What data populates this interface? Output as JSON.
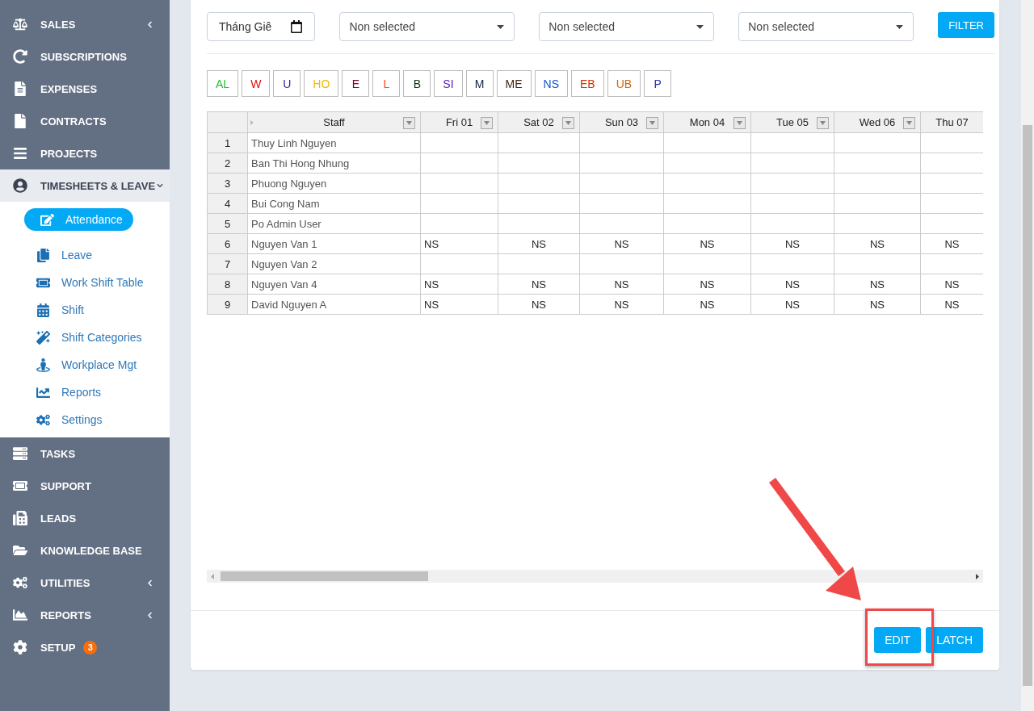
{
  "sidebar": {
    "items": [
      {
        "label": "SALES",
        "expanded": false
      },
      {
        "label": "SUBSCRIPTIONS"
      },
      {
        "label": "EXPENSES"
      },
      {
        "label": "CONTRACTS"
      },
      {
        "label": "PROJECTS"
      },
      {
        "label": "TIMESHEETS & LEAVE",
        "expanded": true,
        "children": [
          {
            "label": "Attendance",
            "selected": true
          },
          {
            "label": "Leave",
            "selected": false
          },
          {
            "label": "Work Shift Table",
            "selected": false
          },
          {
            "label": "Shift",
            "selected": false
          },
          {
            "label": "Shift Categories",
            "selected": false
          },
          {
            "label": "Workplace Mgt",
            "selected": false
          },
          {
            "label": "Reports",
            "selected": false
          },
          {
            "label": "Settings",
            "selected": false
          }
        ]
      },
      {
        "label": "TASKS"
      },
      {
        "label": "SUPPORT"
      },
      {
        "label": "LEADS"
      },
      {
        "label": "KNOWLEDGE BASE"
      },
      {
        "label": "UTILITIES",
        "expanded": false
      },
      {
        "label": "REPORTS",
        "expanded": false
      },
      {
        "label": "SETUP",
        "badge": "3"
      }
    ]
  },
  "filters": {
    "month": {
      "value": "Tháng Giê"
    },
    "selects": [
      {
        "value": "Non selected"
      },
      {
        "value": "Non selected"
      },
      {
        "value": "Non selected"
      }
    ],
    "button": "FILTER"
  },
  "legend": [
    {
      "code": "AL",
      "color": "#22bb33"
    },
    {
      "code": "W",
      "color": "#dd1111"
    },
    {
      "code": "U",
      "color": "#3322aa"
    },
    {
      "code": "HO",
      "color": "#f5b800"
    },
    {
      "code": "E",
      "color": "#770033"
    },
    {
      "code": "L",
      "color": "#ff4422"
    },
    {
      "code": "B",
      "color": "#113311"
    },
    {
      "code": "SI",
      "color": "#5522bb"
    },
    {
      "code": "M",
      "color": "#112244"
    },
    {
      "code": "ME",
      "color": "#442211"
    },
    {
      "code": "NS",
      "color": "#1155cc"
    },
    {
      "code": "EB",
      "color": "#cc3300"
    },
    {
      "code": "UB",
      "color": "#cc6611"
    },
    {
      "code": "P",
      "color": "#2233aa"
    }
  ],
  "table": {
    "columns": [
      "Staff",
      "Fri 01",
      "Sat 02",
      "Sun 03",
      "Mon 04",
      "Tue 05",
      "Wed 06",
      "Thu 07"
    ],
    "rows": [
      {
        "number": "1",
        "cells": [
          "Thuy Linh Nguyen",
          "",
          "",
          "",
          "",
          "",
          "",
          ""
        ]
      },
      {
        "number": "2",
        "cells": [
          "Ban Thi Hong Nhung",
          "",
          "",
          "",
          "",
          "",
          "",
          ""
        ]
      },
      {
        "number": "3",
        "cells": [
          "Phuong Nguyen",
          "",
          "",
          "",
          "",
          "",
          "",
          ""
        ]
      },
      {
        "number": "4",
        "cells": [
          "Bui Cong Nam",
          "",
          "",
          "",
          "",
          "",
          "",
          ""
        ]
      },
      {
        "number": "5",
        "cells": [
          "Po Admin User",
          "",
          "",
          "",
          "",
          "",
          "",
          ""
        ]
      },
      {
        "number": "6",
        "cells": [
          "Nguyen Van 1",
          "NS",
          "NS",
          "NS",
          "NS",
          "NS",
          "NS",
          "NS"
        ]
      },
      {
        "number": "7",
        "cells": [
          "Nguyen Van 2",
          "",
          "",
          "",
          "",
          "",
          "",
          ""
        ]
      },
      {
        "number": "8",
        "cells": [
          "Nguyen Van 4",
          "NS",
          "NS",
          "NS",
          "NS",
          "NS",
          "NS",
          "NS"
        ]
      },
      {
        "number": "9",
        "cells": [
          "David Nguyen A",
          "NS",
          "NS",
          "NS",
          "NS",
          "NS",
          "NS",
          "NS"
        ]
      }
    ]
  },
  "actions": [
    "EDIT",
    "LATCH"
  ]
}
